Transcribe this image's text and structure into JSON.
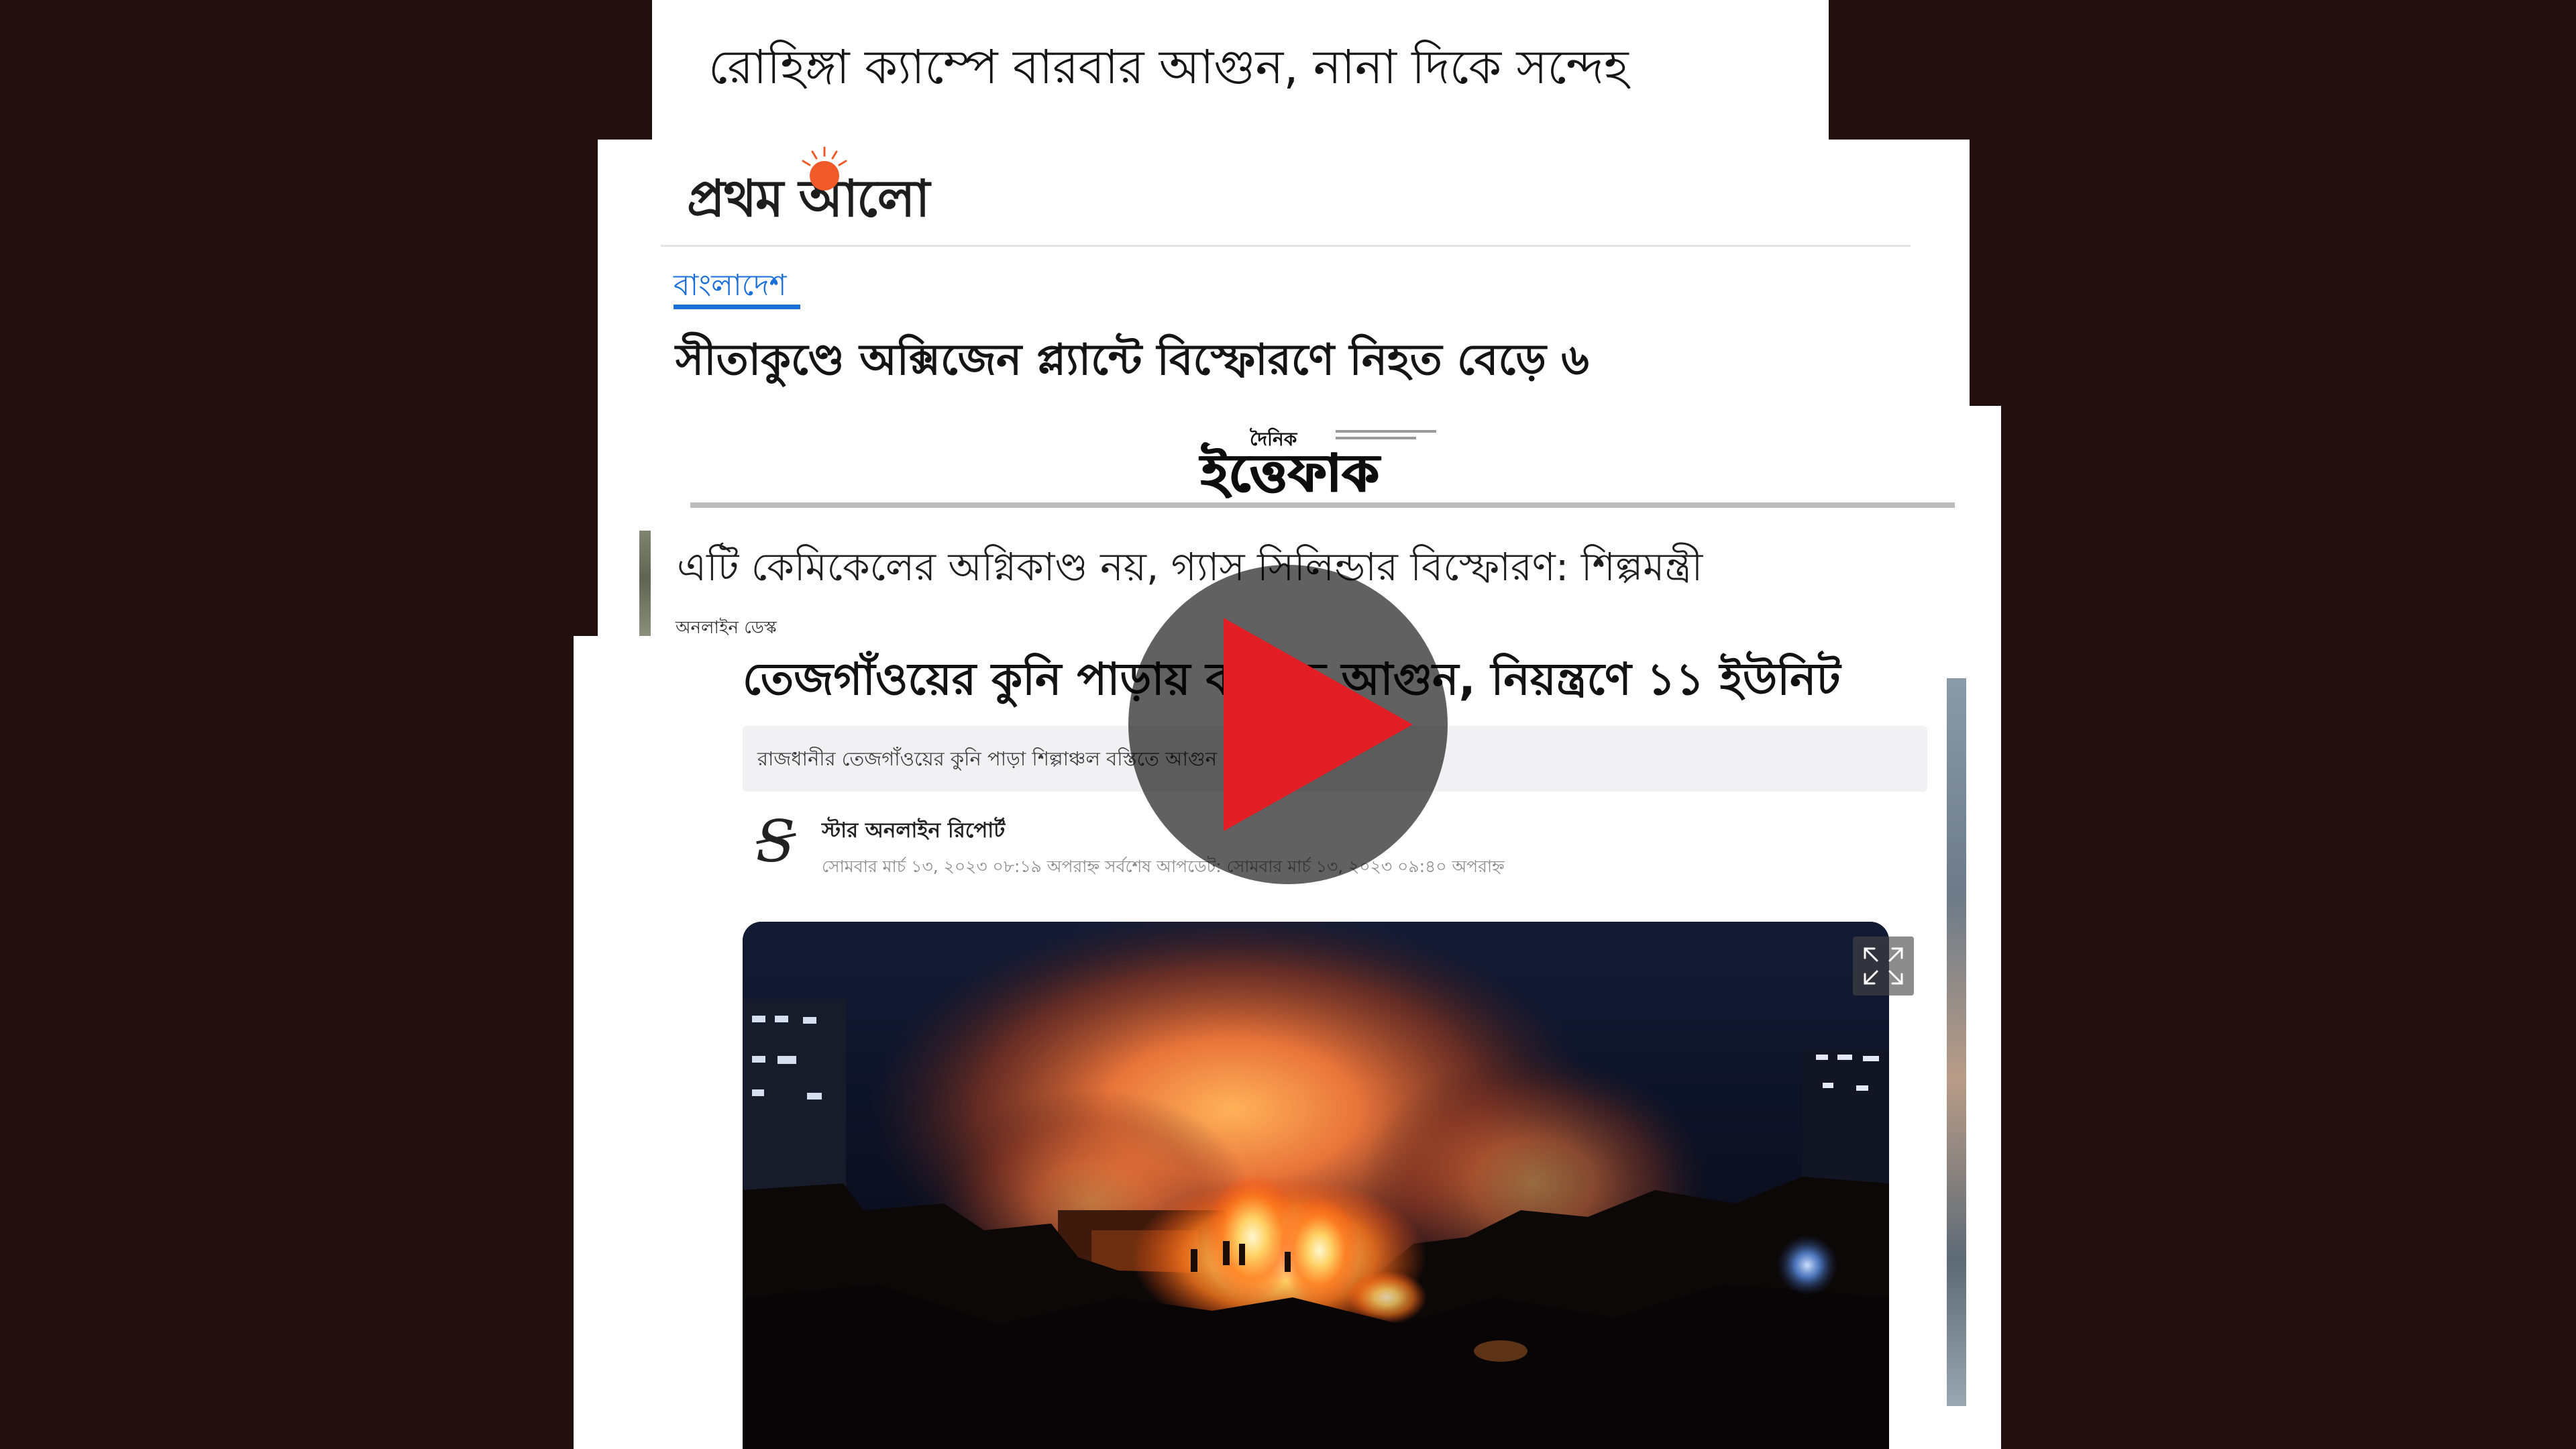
{
  "cards": {
    "rohingya": {
      "headline": "রোহিঙ্গা ক্যাম্পে বারবার আগুন, নানা দিকে সন্দেহ"
    },
    "prothom_alo": {
      "logo_text": "প্রথম আলো",
      "section": "বাংলাদেশ",
      "headline": "সীতাকুণ্ডে অক্সিজেন প্ল্যান্টে বিস্ফোরণে নিহত বেড়ে ৬"
    },
    "ittefaq": {
      "logo_small": "দৈনিক",
      "logo_text": "ইত্তেফাক",
      "headline": "এটি কেমিকেলের অগ্নিকাণ্ড নয়, গ্যাস সিলিন্ডার বিস্ফোরণ: শিল্পমন্ত্রী",
      "byline": "অনলাইন ডেস্ক"
    },
    "daily_star": {
      "headline": "তেজগাঁওয়ের কুনি পাড়ায় বস্তিতে আগুন, নিয়ন্ত্রণে ১১ ইউনিট",
      "summary": "রাজধানীর তেজগাঁওয়ের কুনি পাড়া শিল্পাঞ্চল বস্তিতে আগুন লেগেছে।",
      "logo_glyph": "S",
      "author": "স্টার অনলাইন রিপোর্ট",
      "dateline": "সোমবার মার্চ ১৩, ২০২৩ ০৮:১৯ অপরাহ্ন সর্বশেষ আপডেট: সোমবার মার্চ ১৩, ২০২৩ ০৯:৪০ অপরাহ্ন"
    }
  },
  "icons": {
    "play": "play-icon",
    "expand": "expand-icon",
    "sun": "sun-icon"
  },
  "colors": {
    "background": "#22100f",
    "play_triangle": "#e21d23",
    "section_link": "#1b6fd8",
    "sun": "#f05a28"
  }
}
